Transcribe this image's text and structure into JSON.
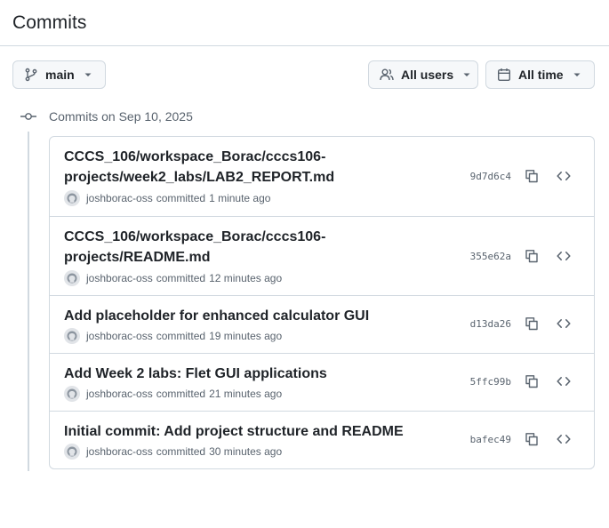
{
  "page": {
    "title": "Commits"
  },
  "filters": {
    "branch": {
      "label": "main",
      "icon": "git-branch-icon"
    },
    "users": {
      "label": "All users",
      "icon": "people-icon"
    },
    "time": {
      "label": "All time",
      "icon": "calendar-icon"
    }
  },
  "group": {
    "label": "Commits on Sep 10, 2025",
    "icon": "git-commit-icon"
  },
  "commits": [
    {
      "title": "CCCS_106/workspace_Borac/cccs106-projects/week2_labs/LAB2_REPORT.md",
      "author": "joshborac-oss",
      "action": "committed",
      "time": "1 minute ago",
      "sha": "9d7d6c4"
    },
    {
      "title": "CCCS_106/workspace_Borac/cccs106-projects/README.md",
      "author": "joshborac-oss",
      "action": "committed",
      "time": "12 minutes ago",
      "sha": "355e62a"
    },
    {
      "title": "Add placeholder for enhanced calculator GUI",
      "author": "joshborac-oss",
      "action": "committed",
      "time": "19 minutes ago",
      "sha": "d13da26"
    },
    {
      "title": "Add Week 2 labs: Flet GUI applications",
      "author": "joshborac-oss",
      "action": "committed",
      "time": "21 minutes ago",
      "sha": "5ffc99b"
    },
    {
      "title": "Initial commit: Add project structure and README",
      "author": "joshborac-oss",
      "action": "committed",
      "time": "30 minutes ago",
      "sha": "bafec49"
    }
  ],
  "colors": {
    "text": "#1f2328",
    "muted": "#59636e",
    "border": "#d1d9e0",
    "button_bg": "#f6f8fa"
  }
}
